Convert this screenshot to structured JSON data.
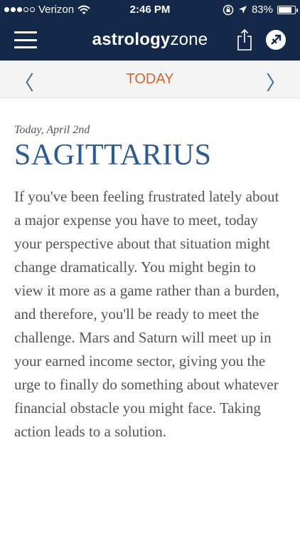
{
  "status_bar": {
    "carrier": "Verizon",
    "signal_bars_filled": 3,
    "signal_bars_total": 5,
    "time": "2:46 PM",
    "battery": "83%",
    "battery_level": 0.83
  },
  "header": {
    "brand_bold": "astrology",
    "brand_light": "zone"
  },
  "date_nav": {
    "label": "TODAY"
  },
  "horoscope": {
    "date": "Today, April 2nd",
    "sign": "SAGITTARIUS",
    "text": "If you've been feeling frustrated lately about a major expense you have to meet, today your perspective about that situation might change dramatically. You might begin to view it more as a game rather than a burden, and therefore, you'll be ready to meet the challenge. Mars and Saturn will meet up in your earned income sector, giving you the urge to finally do something about whatever financial obstacle you might face. Taking action leads to a solution."
  },
  "colors": {
    "header_bg": "#14294a",
    "accent_orange": "#d8642d",
    "sign_blue": "#2c5a96"
  },
  "icons": [
    "signal-dots-icon",
    "wifi-icon",
    "orientation-lock-icon",
    "location-arrow-icon",
    "battery-icon",
    "hamburger-menu-icon",
    "share-icon",
    "sagittarius-icon",
    "chevron-left-icon",
    "chevron-right-icon"
  ]
}
